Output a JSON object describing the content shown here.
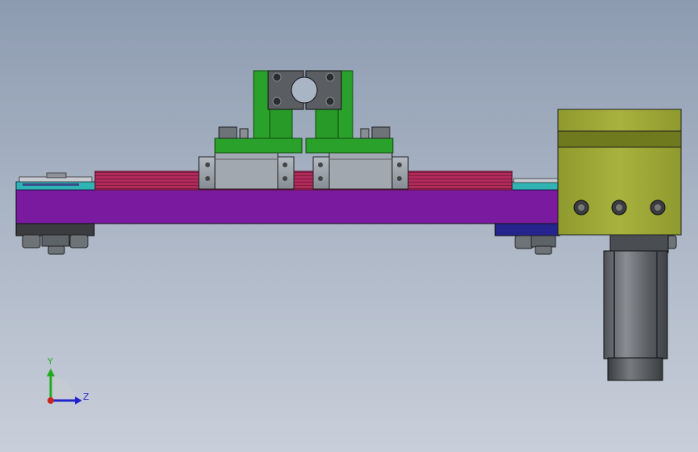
{
  "viewport": {
    "background_top": "#8d9bb1",
    "background_bottom": "#c9cfda"
  },
  "model": {
    "colors": {
      "base_plate": "#7a1a9e",
      "belt_red": "#b02a5a",
      "rail_teal": "#2fb3b3",
      "bracket_green": "#2aa12a",
      "clamp_dark": "#5a5e63",
      "carriage_gray": "#9aa0a8",
      "motor_box": "#9aa33a",
      "motor_body": "#6f7378",
      "lower_plate_navy": "#24248c"
    }
  },
  "triad": {
    "y_label": "Y",
    "z_label": "Z",
    "y_color": "#1faa1f",
    "z_color": "#2222cc",
    "x_color": "#cc2222",
    "icon": "coordinate-triad-icon"
  }
}
